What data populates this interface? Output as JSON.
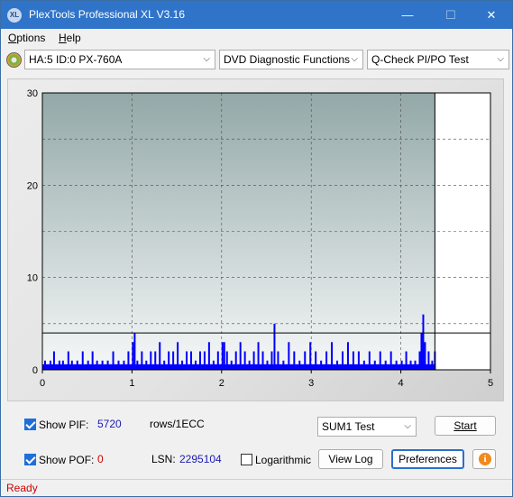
{
  "window": {
    "title": "PlexTools Professional XL V3.16",
    "icon_text": "XL",
    "minimize_glyph": "—",
    "maximize_glyph": "☐",
    "close_glyph": "✕"
  },
  "menu": {
    "options": {
      "u": "O",
      "rest": "ptions"
    },
    "help": {
      "u": "H",
      "rest": "elp"
    }
  },
  "toolbar": {
    "drive": "HA:5 ID:0  PX-760A",
    "function": "DVD Diagnostic Functions",
    "test": "Q-Check PI/PO Test"
  },
  "chart_data": {
    "type": "bar",
    "x_range": [
      0,
      5
    ],
    "y_range": [
      0,
      30
    ],
    "x_ticks": [
      "0",
      "1",
      "2",
      "3",
      "4",
      "5"
    ],
    "y_ticks": [
      "0",
      "10",
      "20",
      "30"
    ],
    "grid": true,
    "threshold_y": 4,
    "end_marker_x": 4.38,
    "series": [
      {
        "color": "#0000ff",
        "x": [
          0.02,
          0.08,
          0.12,
          0.18,
          0.22,
          0.28,
          0.32,
          0.38,
          0.44,
          0.5,
          0.55,
          0.6,
          0.66,
          0.72,
          0.78,
          0.84,
          0.9,
          0.95,
          1.0,
          1.02,
          1.05,
          1.1,
          1.15,
          1.2,
          1.25,
          1.3,
          1.35,
          1.4,
          1.45,
          1.5,
          1.55,
          1.6,
          1.65,
          1.7,
          1.75,
          1.8,
          1.85,
          1.9,
          1.95,
          2.0,
          2.02,
          2.05,
          2.1,
          2.15,
          2.2,
          2.25,
          2.3,
          2.35,
          2.4,
          2.45,
          2.5,
          2.55,
          2.58,
          2.62,
          2.68,
          2.74,
          2.8,
          2.86,
          2.92,
          2.98,
          3.04,
          3.1,
          3.16,
          3.22,
          3.28,
          3.34,
          3.4,
          3.46,
          3.52,
          3.58,
          3.64,
          3.7,
          3.76,
          3.82,
          3.88,
          3.94,
          4.0,
          4.05,
          4.1,
          4.15,
          4.2,
          4.22,
          4.24,
          4.26,
          4.3,
          4.34,
          4.37
        ],
        "values": [
          1,
          1,
          2,
          1,
          1,
          2,
          1,
          1,
          2,
          1,
          2,
          1,
          1,
          1,
          2,
          1,
          1,
          2,
          3,
          4,
          1,
          2,
          1,
          2,
          2,
          3,
          1,
          2,
          2,
          3,
          1,
          2,
          2,
          1,
          2,
          2,
          3,
          1,
          2,
          3,
          3,
          2,
          1,
          2,
          3,
          2,
          1,
          2,
          3,
          2,
          1,
          2,
          5,
          2,
          1,
          3,
          2,
          1,
          2,
          3,
          2,
          1,
          2,
          3,
          1,
          2,
          3,
          2,
          2,
          1,
          2,
          1,
          2,
          1,
          2,
          1,
          1,
          2,
          1,
          1,
          2,
          4,
          6,
          3,
          2,
          1,
          2
        ]
      }
    ]
  },
  "bottom": {
    "show_pif_label": "Show PIF:",
    "show_pif_value": "5720",
    "rows_label": "rows/1ECC",
    "show_pof_label": "Show POF:",
    "show_pof_value": "0",
    "lsn_label": "LSN:",
    "lsn_value": "2295104",
    "logarithmic_label": "Logarithmic",
    "sum_test": "SUM1 Test",
    "start_label": "Start",
    "view_log_label": "View Log",
    "preferences_label": "Preferences",
    "info_glyph": "i"
  },
  "status": {
    "text": "Ready"
  }
}
